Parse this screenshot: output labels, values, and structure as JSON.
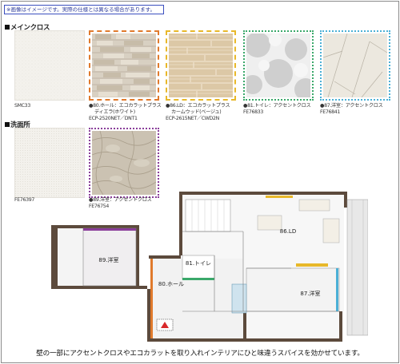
{
  "note": "※画像はイメージです。実際の仕様とは異なる場合があります。",
  "sections": {
    "main_cloth": "メインクロス",
    "washroom": "洗面所"
  },
  "swatches": [
    {
      "label": "",
      "code": "SMC33"
    },
    {
      "label": "●80.ホール：エコカラットプラス",
      "label2": "ディエラ(ホワイト)",
      "code": "ECP-2520NET／DNT1",
      "border": "#e07a2c"
    },
    {
      "label": "●86.LD：エコカラットプラス",
      "label2": "カームウッド(ベージュ)",
      "code": "ECP-2615NET／CWD2N",
      "border": "#e8b82a"
    },
    {
      "label": "●81.トイレ：アクセントクロス",
      "code": "FE76833",
      "border": "#3aa86a"
    },
    {
      "label": "●87.洋室：アクセントクロス",
      "code": "FE76841",
      "border": "#4bb0d6"
    },
    {
      "label": "",
      "code": "FE76397"
    },
    {
      "label": "●89.洋室：アクセントクロス",
      "code": "FE76754",
      "border": "#8a3e9a"
    }
  ],
  "floorplan": {
    "rooms": [
      "86.LD",
      "89.洋室",
      "81.トイレ",
      "80.ホール",
      "87.洋室"
    ]
  },
  "caption": "壁の一部にアクセントクロスやエコカラットを取り入れインテリアにひと味違うスパイスを効かせています。"
}
